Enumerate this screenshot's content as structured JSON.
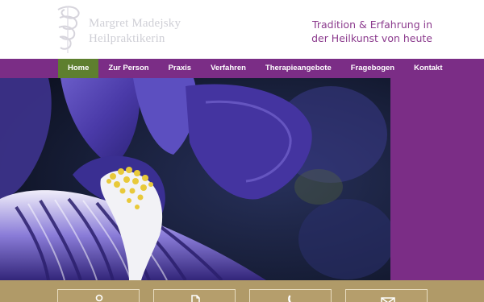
{
  "header": {
    "logo_line1": "Margret Madejsky",
    "logo_line2": "Heilpraktikerin",
    "tagline_line1": "Tradition & Erfahrung in",
    "tagline_line2": "der Heilkunst von heute"
  },
  "nav": {
    "items": [
      {
        "label": "Home"
      },
      {
        "label": "Zur Person"
      },
      {
        "label": "Praxis"
      },
      {
        "label": "Verfahren"
      },
      {
        "label": "Therapieangebote"
      },
      {
        "label": "Fragebogen"
      },
      {
        "label": "Kontakt"
      }
    ],
    "active_index": 0
  },
  "bottom_tiles": [
    {
      "icon": "person-icon"
    },
    {
      "icon": "document-icon"
    },
    {
      "icon": "phone-icon"
    },
    {
      "icon": "mail-icon"
    }
  ],
  "colors": {
    "brand_purple": "#7b2d86",
    "active_green": "#5e7f2f",
    "tagline_purple": "#8b3a8d",
    "footer_gold": "#b09a68"
  }
}
